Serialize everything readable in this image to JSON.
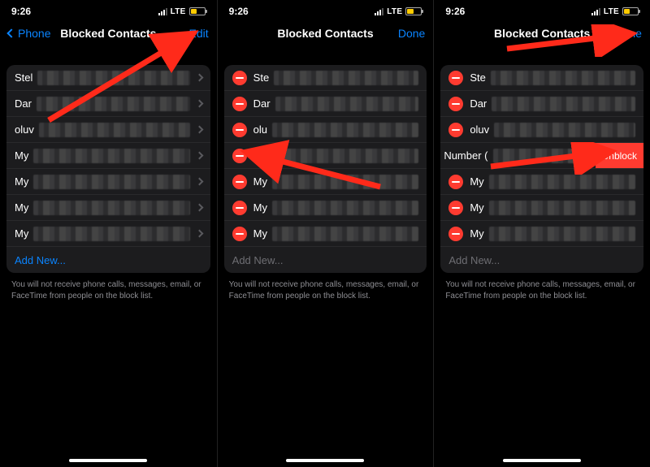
{
  "status": {
    "time": "9:26",
    "network": "LTE"
  },
  "nav": {
    "back_label": "Phone",
    "title": "Blocked Contacts",
    "edit_label": "Edit",
    "done_label": "Done"
  },
  "footer": "You will not receive phone calls, messages, email, or FaceTime from people on the block list.",
  "add_new": "Add New...",
  "unblock_label": "Unblock",
  "shifted_row_label": "Number (",
  "panel1_rows": [
    "Stel",
    "Dar",
    "oluv",
    "My",
    "My",
    "My",
    "My"
  ],
  "panel2_rows": [
    "Ste",
    "Dar",
    "olu",
    "",
    "My",
    "My",
    "My"
  ],
  "panel3_rows": [
    "Ste",
    "Dar",
    "oluv",
    "My",
    "My",
    "My"
  ],
  "colors": {
    "accent": "#0a84ff",
    "destructive": "#ff3b30"
  }
}
